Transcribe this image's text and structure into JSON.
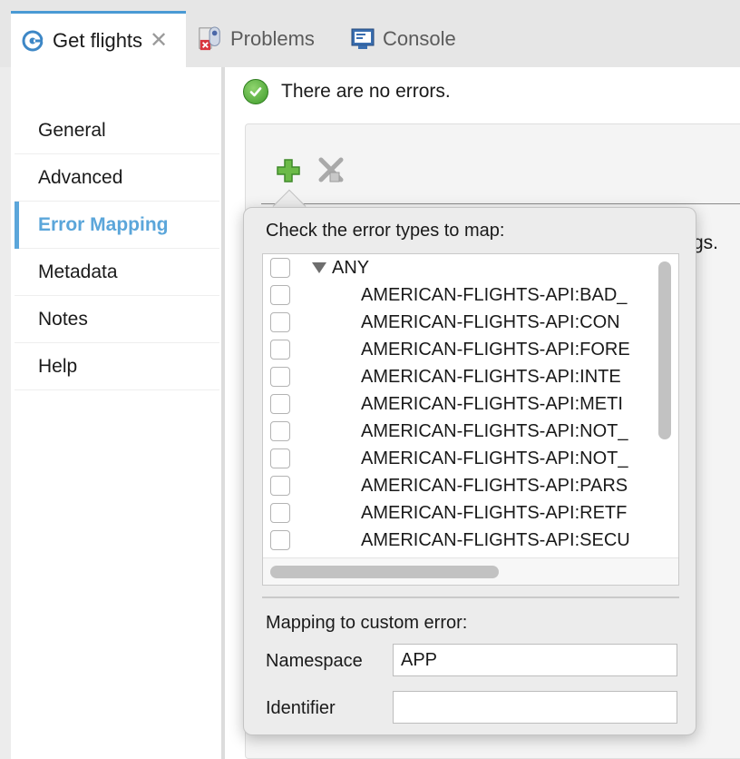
{
  "tabs": [
    {
      "label": "Get flights",
      "active": true,
      "icon": "flow-icon"
    },
    {
      "label": "Problems",
      "active": false,
      "icon": "problems-icon"
    },
    {
      "label": "Console",
      "active": false,
      "icon": "console-icon"
    }
  ],
  "sidebar": {
    "items": [
      {
        "label": "General"
      },
      {
        "label": "Advanced"
      },
      {
        "label": "Error Mapping",
        "selected": true
      },
      {
        "label": "Metadata"
      },
      {
        "label": "Notes"
      },
      {
        "label": "Help"
      }
    ]
  },
  "status": {
    "text": "There are no errors."
  },
  "panel": {
    "partial_text": "gs."
  },
  "popover": {
    "title": "Check the error types to map:",
    "tree": {
      "root": "ANY",
      "items": [
        "AMERICAN-FLIGHTS-API:BAD_",
        "AMERICAN-FLIGHTS-API:CON",
        "AMERICAN-FLIGHTS-API:FORE",
        "AMERICAN-FLIGHTS-API:INTE",
        "AMERICAN-FLIGHTS-API:METI",
        "AMERICAN-FLIGHTS-API:NOT_",
        "AMERICAN-FLIGHTS-API:NOT_",
        "AMERICAN-FLIGHTS-API:PARS",
        "AMERICAN-FLIGHTS-API:RETF",
        "AMERICAN-FLIGHTS-API:SECU"
      ]
    },
    "mapping_title": "Mapping to custom error:",
    "namespace": {
      "label": "Namespace",
      "value": "APP"
    },
    "identifier": {
      "label": "Identifier",
      "value": ""
    }
  },
  "colors": {
    "accent": "#5ba6da",
    "success": "#3e9b2a",
    "add": "#5aa83a"
  }
}
